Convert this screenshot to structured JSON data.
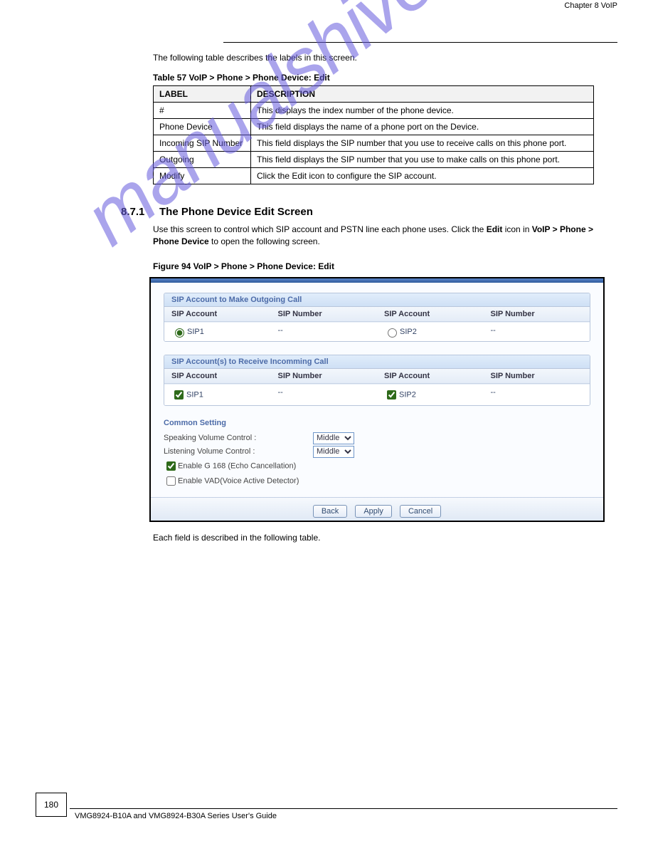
{
  "header": {
    "text": "Chapter 8 VoIP"
  },
  "intro": "The following table describes the labels in this screen.",
  "table_caption": "Table 57   VoIP > Phone > Phone Device: Edit",
  "label_table": {
    "cols": [
      "LABEL",
      "DESCRIPTION"
    ],
    "rows": [
      [
        "#",
        "This displays the index number of the phone device."
      ],
      [
        "Phone Device",
        "This field displays the name of a phone port on the Device."
      ],
      [
        "Incoming SIP Number",
        "This field displays the SIP number that you use to receive calls on this phone port."
      ],
      [
        "Outgoing",
        "This field displays the SIP number that you use to make calls on this phone port."
      ],
      [
        "Modify",
        "Click the Edit icon to configure the SIP account."
      ]
    ]
  },
  "section": {
    "number": "8.7.1",
    "title": "The Phone Device Edit Screen",
    "p1_pre": "Use this screen to control which SIP account and PSTN line each phone uses. Click the ",
    "p1_bold": "Edit",
    "p1_mid": " icon in ",
    "p1_bold2": "VoIP > Phone > Phone Device",
    "p1_post": " to open the following screen."
  },
  "figure_caption": "Figure 94   VoIP > Phone > Phone Device: Edit",
  "ui": {
    "panel1_title": "SIP Account to Make Outgoing Call",
    "panel2_title": "SIP Account(s) to Receive Incomming Call",
    "headers": {
      "acct": "SIP Account",
      "num": "SIP Number"
    },
    "outgoing": [
      {
        "label": "SIP1",
        "selected": true,
        "number": "--"
      },
      {
        "label": "SIP2",
        "selected": false,
        "number": "--"
      }
    ],
    "incoming": [
      {
        "label": "SIP1",
        "checked": true,
        "number": "--"
      },
      {
        "label": "SIP2",
        "checked": true,
        "number": "--"
      }
    ],
    "common_heading": "Common Setting",
    "speak_label": "Speaking Volume Control :",
    "listen_label": "Listening Volume Control :",
    "volume_value": "Middle",
    "g168_label": "Enable G 168 (Echo Cancellation)",
    "g168_checked": true,
    "vad_label": "Enable VAD(Voice Active Detector)",
    "vad_checked": false,
    "buttons": {
      "back": "Back",
      "apply": "Apply",
      "cancel": "Cancel"
    }
  },
  "post_text": "Each field is described in the following table.",
  "footer": {
    "page": "180",
    "text": "VMG8924-B10A and VMG8924-B30A Series User's Guide"
  },
  "watermark": "manualshive.com"
}
